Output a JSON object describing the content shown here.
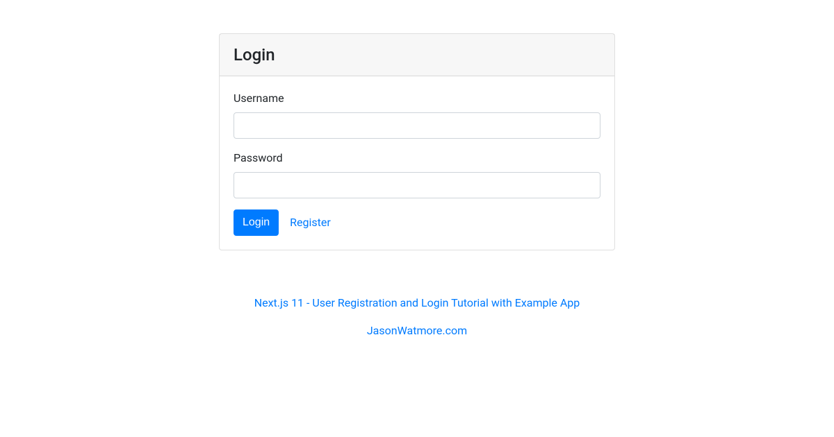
{
  "card": {
    "title": "Login"
  },
  "form": {
    "username": {
      "label": "Username",
      "value": ""
    },
    "password": {
      "label": "Password",
      "value": ""
    },
    "submit_label": "Login",
    "register_label": "Register"
  },
  "footer": {
    "tutorial_link": "Next.js 11 - User Registration and Login Tutorial with Example App",
    "site_link": "JasonWatmore.com"
  }
}
